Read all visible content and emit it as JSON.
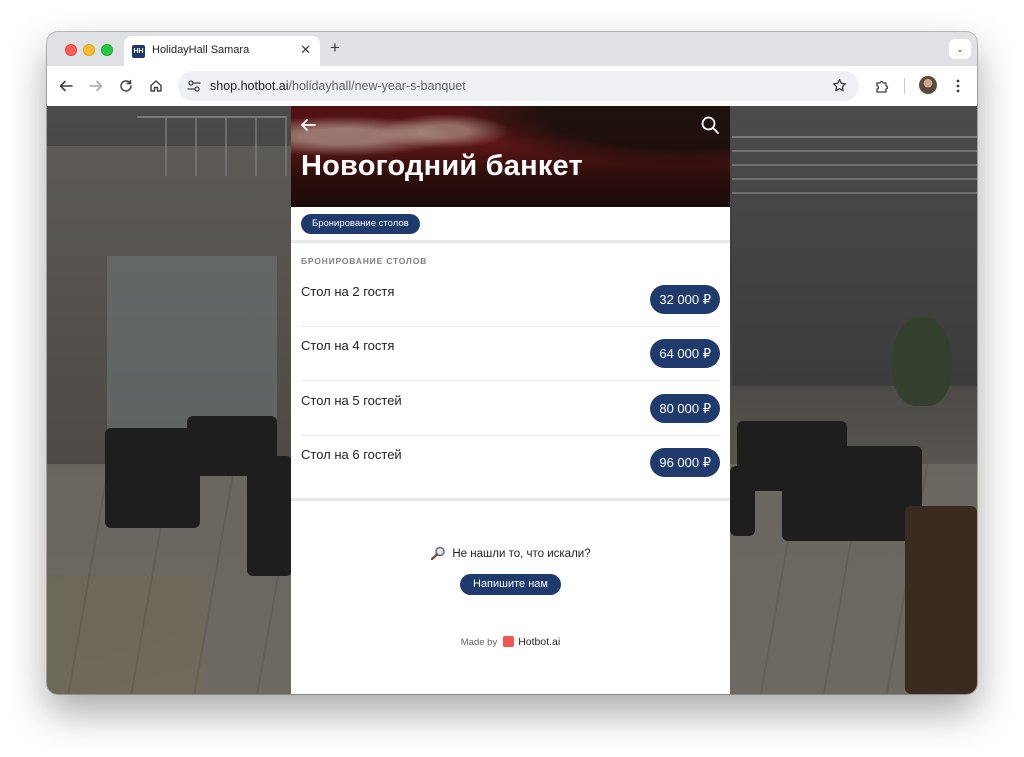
{
  "browser": {
    "tab_title": "HolidayHall Samara",
    "tab_favicon_text": "HH",
    "url_host": "shop.hotbot.ai",
    "url_path": "/holidayhall/new-year-s-banquet"
  },
  "hero": {
    "title": "Новогодний банкет"
  },
  "chips": [
    {
      "label": "Бронирование столов"
    }
  ],
  "section": {
    "label": "БРОНИРОВАНИЕ СТОЛОВ",
    "items": [
      {
        "title": "Стол на 2 гостя",
        "price": "32 000 ₽"
      },
      {
        "title": "Стол на 4 гостя",
        "price": "64 000 ₽"
      },
      {
        "title": "Стол на 5 гостей",
        "price": "80 000 ₽"
      },
      {
        "title": "Стол на 6 гостей",
        "price": "96 000 ₽"
      }
    ]
  },
  "footer": {
    "not_found_text": "Не нашли то, что искали?",
    "write_button": "Напишите нам",
    "made_by": "Made by",
    "brand": "Hotbot.ai"
  },
  "colors": {
    "accent": "#1f3a6d",
    "brand_logo": "#f0554f"
  }
}
